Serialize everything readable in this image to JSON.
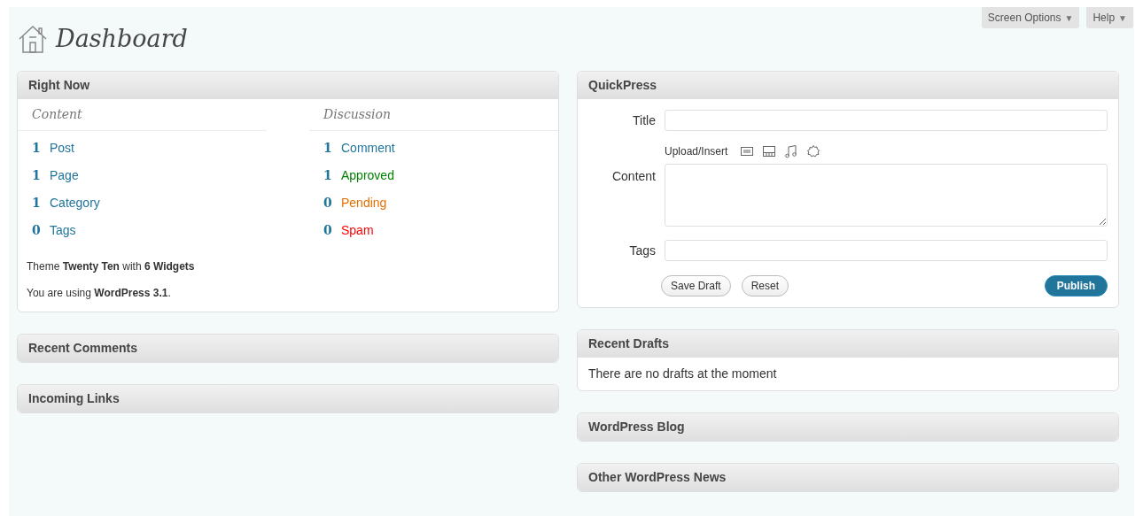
{
  "header": {
    "title": "Dashboard",
    "buttons": [
      {
        "label": "Screen Options",
        "symbol": "▼"
      },
      {
        "label": "Help",
        "symbol": "▼"
      }
    ]
  },
  "left_column": [
    {
      "kind": "right_now",
      "title": "Right Now",
      "content": {
        "heading": "Content",
        "items": [
          {
            "count": "1",
            "label": "Post",
            "color": "#21759b"
          },
          {
            "count": "1",
            "label": "Page",
            "color": "#21759b"
          },
          {
            "count": "1",
            "label": "Category",
            "color": "#21759b"
          },
          {
            "count": "0",
            "label": "Tags",
            "color": "#21759b"
          }
        ]
      },
      "discussion": {
        "heading": "Discussion",
        "items": [
          {
            "count": "1",
            "label": "Comment",
            "color": "#21759b"
          },
          {
            "count": "1",
            "label": "Approved",
            "color": "#008000"
          },
          {
            "count": "0",
            "label": "Pending",
            "color": "#e66f00"
          },
          {
            "count": "0",
            "label": "Spam",
            "color": "#ff0000"
          }
        ]
      },
      "notes": [
        "Theme **Twenty Ten** with **6 Widgets**",
        "You are using **WordPress 3.1**."
      ]
    },
    {
      "kind": "collapsed",
      "title": "Recent Comments"
    },
    {
      "kind": "collapsed",
      "title": "Incoming Links"
    }
  ],
  "right_column": [
    {
      "kind": "quickpress",
      "title": "QuickPress",
      "title_label": "Title",
      "upload_label": "Upload/Insert",
      "content_label": "Content",
      "tags_label": "Tags",
      "buttons": [
        "Save Draft",
        "Reset"
      ],
      "publish": "Publish"
    },
    {
      "kind": "message",
      "title": "Recent Drafts",
      "message": "There are no drafts at the moment"
    },
    {
      "kind": "collapsed",
      "title": "WordPress Blog"
    },
    {
      "kind": "collapsed",
      "title": "Other WordPress News"
    }
  ]
}
